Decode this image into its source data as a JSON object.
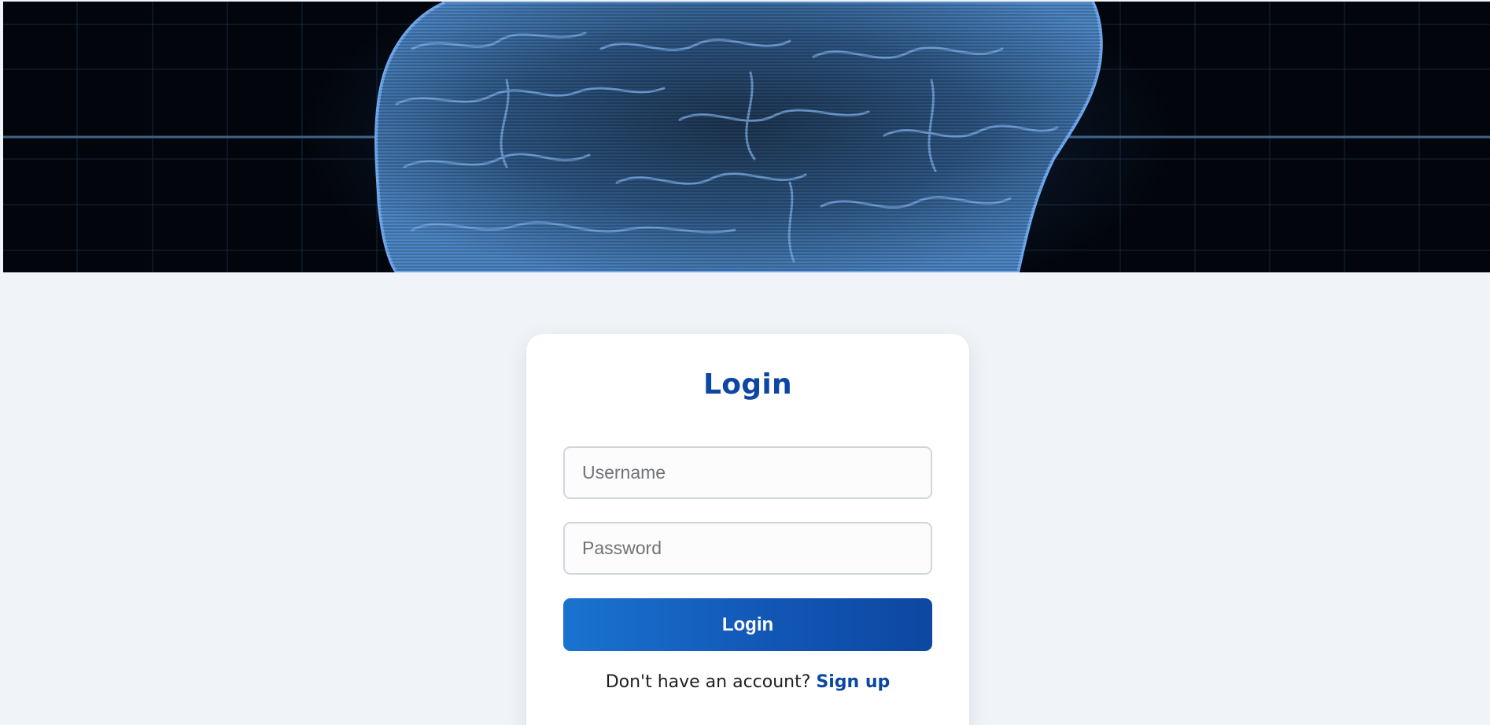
{
  "hero": {
    "image": "brain-hologram-banner",
    "colors": {
      "background": "#02050b",
      "grid": "#1f3550",
      "brain": "#3a6fa8",
      "glow": "#5aa0ff"
    }
  },
  "login": {
    "title": "Login",
    "username_placeholder": "Username",
    "password_placeholder": "Password",
    "submit_label": "Login",
    "signup_prompt": "Don't have an account?",
    "signup_link": "Sign up"
  },
  "colors": {
    "page_background": "#f0f4f8",
    "accent": "#0d47a1",
    "button_gradient_start": "#1a73d0",
    "button_gradient_end": "#0d47a1"
  }
}
